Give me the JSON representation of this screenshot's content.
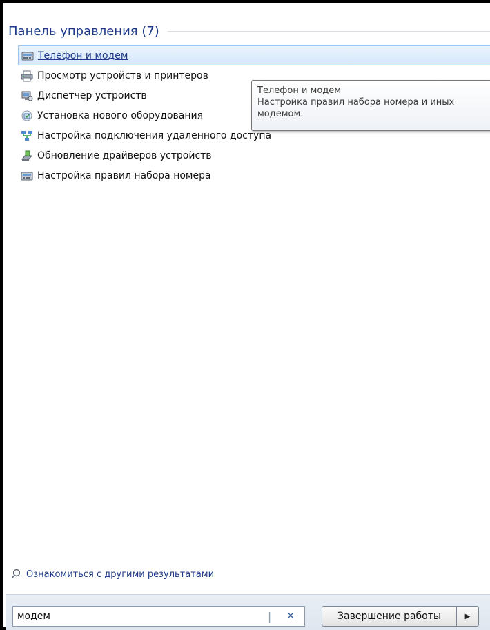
{
  "group": {
    "title": "Панель управления (7)"
  },
  "results": [
    {
      "label": "Телефон и модем",
      "icon": "phone-modem-icon",
      "hovered": true
    },
    {
      "label": "Просмотр устройств и принтеров",
      "icon": "printer-icon"
    },
    {
      "label": "Диспетчер устройств",
      "icon": "device-manager-icon"
    },
    {
      "label": "Установка нового оборудования",
      "icon": "new-hardware-icon"
    },
    {
      "label": "Настройка подключения удаленного доступа",
      "icon": "network-icon"
    },
    {
      "label": "Обновление драйверов устройств",
      "icon": "driver-update-icon"
    },
    {
      "label": "Настройка правил набора номера",
      "icon": "dialing-rules-icon"
    }
  ],
  "tooltip": {
    "title": "Телефон и модем",
    "line1": "Настройка правил набора номера и иных",
    "line2": "модемом."
  },
  "more_results": {
    "label": "Ознакомиться с другими результатами"
  },
  "search": {
    "value": "модем",
    "clear_icon": "close-icon"
  },
  "shutdown": {
    "label": "Завершение работы",
    "arrow_icon": "chevron-right-icon"
  },
  "colors": {
    "accent": "#1e3a8a",
    "hover_bg": "#d6e8fb",
    "hover_border": "#9dc6ee"
  }
}
